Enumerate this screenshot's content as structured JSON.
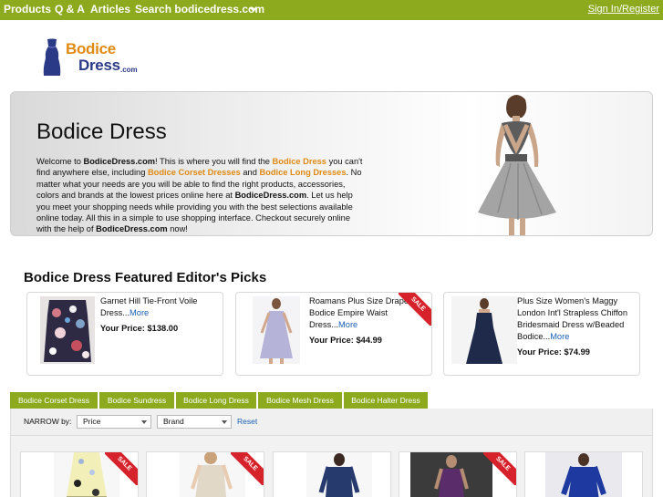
{
  "nav": {
    "items": [
      "Products",
      "Q & A",
      "Articles",
      "Search bodicedress.com"
    ],
    "signin": "Sign In/Register",
    "colors": {
      "bar": "#8daa1e",
      "text": "#ffffff"
    }
  },
  "logo": {
    "word1": "Bodice",
    "word2": "Dress",
    "suffix": ".com"
  },
  "hero": {
    "title": "Bodice Dress",
    "intro": {
      "t1": "Welcome to ",
      "b1": "BodiceDress.com",
      "t2": "! This is where you will find the ",
      "h1": "Bodice Dress",
      "t3": " you can't find anywhere else, including ",
      "h2": "Bodice Corset Dresses",
      "t4": " and ",
      "h3": "Bodice Long Dresses",
      "t5": ". No matter what your needs are you will be able to find the right products, accessories, colors and brands at the lowest prices online here at ",
      "b2": "BodiceDress.com",
      "t6": ". Let us help you meet your shopping needs while providing you with the best selections available online today. All this in a simple to use shopping interface. Checkout securely online with the help of ",
      "b3": "BodiceDress.com",
      "t7": " now!"
    }
  },
  "featured": {
    "title": "Bodice Dress Featured Editor's Picks",
    "more_label": "More",
    "price_label": "Your Price:",
    "sale_label": "SALE",
    "picks": [
      {
        "name": "Garnet Hill Tie-Front Voile Dress...",
        "price": "$138.00",
        "sale": false
      },
      {
        "name": "Roamans Plus Size Draped Bodice Empire Waist Dress...",
        "price": "$44.99",
        "sale": true
      },
      {
        "name": "Plus Size Women's Maggy London Int'l Strapless Chiffon Bridesmaid Dress w/Beaded Bodice...",
        "price": "$74.99",
        "sale": false
      }
    ]
  },
  "tabs": [
    "Bodice Corset Dress",
    "Bodice Sundress",
    "Bodice Long Dress",
    "Bodice Mesh Dress",
    "Bodice Halter Dress"
  ],
  "filter": {
    "label": "NARROW by:",
    "price": "Price",
    "brand": "Brand",
    "reset": "Reset"
  },
  "products": {
    "sale_flags": [
      true,
      true,
      false,
      true,
      false
    ],
    "sale_label": "SALE"
  },
  "colors": {
    "accent": "#8daa1e",
    "sale": "#d6222a",
    "link": "#1a5fb4",
    "highlight": "#e08a12",
    "logo_blue": "#2b3a86"
  }
}
